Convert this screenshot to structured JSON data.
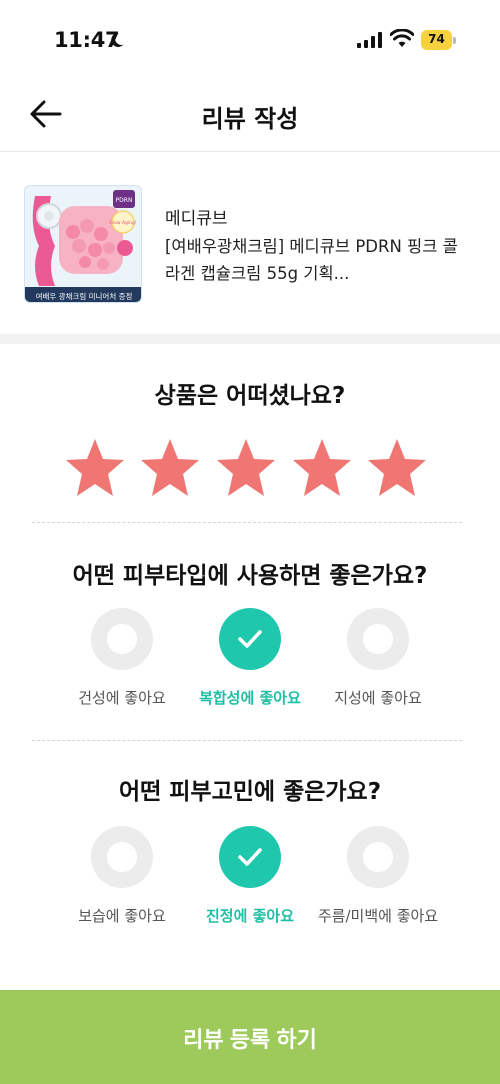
{
  "status_bar": {
    "time": "11:47",
    "battery_level": "74",
    "colors": {
      "battery": "#f7d23e"
    }
  },
  "header": {
    "title": "리뷰 작성",
    "back_icon": "arrow-left-icon"
  },
  "product": {
    "brand": "메디큐브",
    "name": "[여배우광채크림] 메디큐브 PDRN 핑크 콜라겐 캡슐크림 55g 기획...",
    "image_caption": "여배우 광채크림 미니어처 증정",
    "image_badge": "Glow Aging!",
    "image_tag": "PDRN"
  },
  "rating": {
    "question": "상품은 어떠셨나요?",
    "max_stars": 5,
    "value": 5,
    "star_icon": "star-icon",
    "colors": {
      "filled": "#f07673"
    }
  },
  "skin_type": {
    "question": "어떤 피부타입에 사용하면 좋은가요?",
    "options": [
      {
        "label": "건성에 좋아요",
        "selected": false
      },
      {
        "label": "복합성에 좋아요",
        "selected": true
      },
      {
        "label": "지성에 좋아요",
        "selected": false
      }
    ]
  },
  "skin_concern": {
    "question": "어떤 피부고민에 좋은가요?",
    "options": [
      {
        "label": "보습에 좋아요",
        "selected": false
      },
      {
        "label": "진정에 좋아요",
        "selected": true
      },
      {
        "label": "주름/미백에 좋아요",
        "selected": false
      }
    ]
  },
  "submit": {
    "label": "리뷰 등록 하기",
    "colors": {
      "background": "#9dca5a"
    }
  },
  "colors": {
    "accent": "#1fc7ad",
    "unselected": "#ececec"
  }
}
